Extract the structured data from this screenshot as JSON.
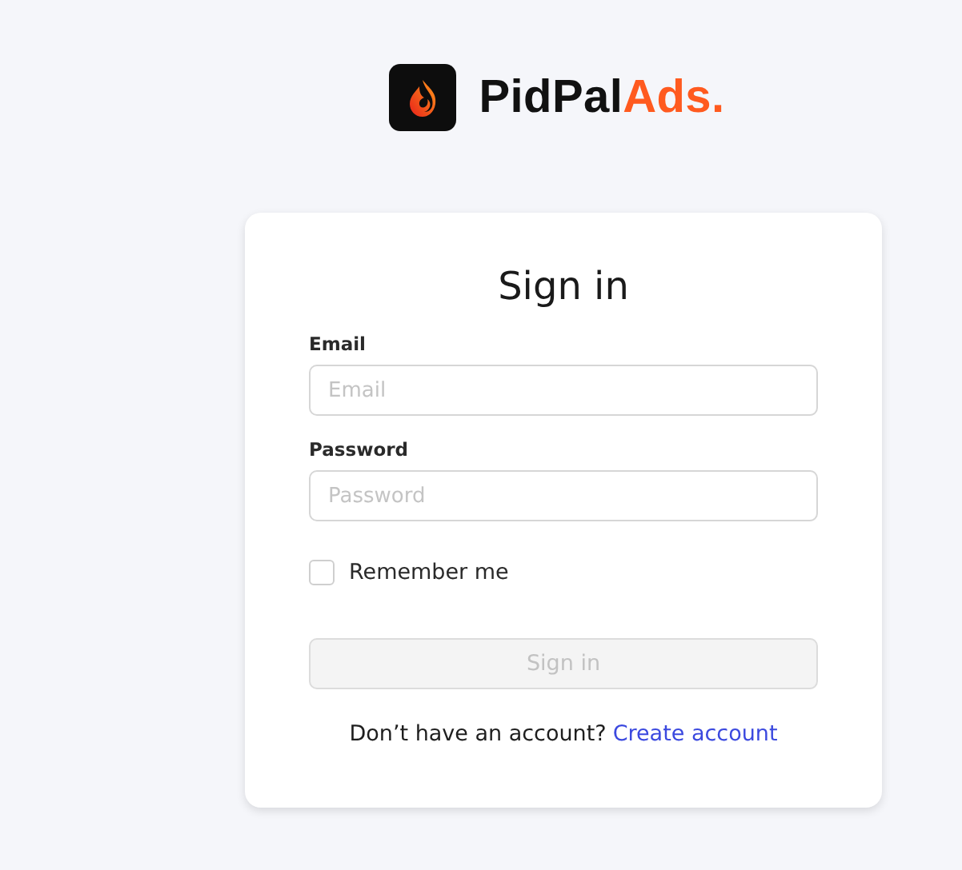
{
  "logo": {
    "text": "PidPal",
    "accent": "Ads."
  },
  "card": {
    "title": "Sign in",
    "fields": [
      {
        "label": "Email",
        "placeholder": "Email"
      },
      {
        "label": "Password",
        "placeholder": "Password"
      }
    ],
    "remember": {
      "label": "Remember me",
      "checked": false
    },
    "submit": {
      "label": "Sign in",
      "disabled": true
    },
    "footer": {
      "text": "Don’t have an account?",
      "link": "Create account"
    }
  }
}
